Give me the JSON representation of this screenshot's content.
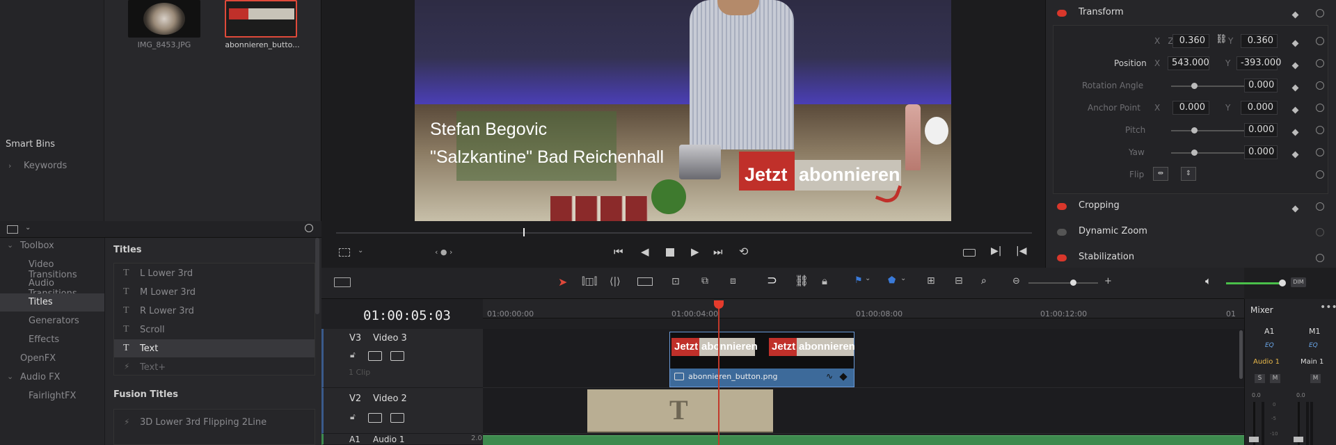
{
  "media_pool": {
    "clips": [
      {
        "label": "IMG_8453.JPG"
      },
      {
        "label": "abonnieren_butto..."
      }
    ],
    "smart_bins_label": "Smart Bins",
    "keywords_label": "Keywords"
  },
  "viewer": {
    "overlay_line1": "Stefan Begovic",
    "overlay_line2": "\"Salzkantine\" Bad Reichenhall",
    "button_text_1": "Jetzt",
    "button_text_2": "abonnieren"
  },
  "inspector": {
    "transform_label": "Transform",
    "zoom_label": "Zoom",
    "zoom_x": "0.360",
    "zoom_y": "0.360",
    "position_label": "Position",
    "position_x": "543.000",
    "position_y": "-393.000",
    "rotation_label": "Rotation Angle",
    "rotation_value": "0.000",
    "anchor_label": "Anchor Point",
    "anchor_x": "0.000",
    "anchor_y": "0.000",
    "pitch_label": "Pitch",
    "pitch_value": "0.000",
    "yaw_label": "Yaw",
    "yaw_value": "0.000",
    "flip_label": "Flip",
    "x_axis": "X",
    "y_axis": "Y",
    "cropping_label": "Cropping",
    "dynamic_zoom_label": "Dynamic Zoom",
    "stabilization_label": "Stabilization"
  },
  "effects": {
    "toolbox": [
      {
        "label": "Toolbox"
      },
      {
        "label": "Video Transitions"
      },
      {
        "label": "Audio Transitions"
      },
      {
        "label": "Titles"
      },
      {
        "label": "Generators"
      },
      {
        "label": "Effects"
      },
      {
        "label": "OpenFX"
      },
      {
        "label": "Audio FX"
      },
      {
        "label": "FairlightFX"
      }
    ],
    "titles_header": "Titles",
    "titles": [
      {
        "label": "L Lower 3rd"
      },
      {
        "label": "M Lower 3rd"
      },
      {
        "label": "R Lower 3rd"
      },
      {
        "label": "Scroll"
      },
      {
        "label": "Text"
      },
      {
        "label": "Text+"
      }
    ],
    "fusion_header": "Fusion Titles",
    "fusion_items": [
      {
        "label": "3D Lower 3rd Flipping 2Line"
      }
    ]
  },
  "timeline": {
    "timecode": "01:00:05:03",
    "ruler": [
      "01:00:00:00",
      "01:00:04:00",
      "01:00:08:00",
      "01:00:12:00",
      "01"
    ],
    "tracks": [
      {
        "id": "V3",
        "name": "Video 3",
        "clips": "1 Clip"
      },
      {
        "id": "V2",
        "name": "Video 2"
      },
      {
        "id": "A1",
        "name": "Audio 1",
        "level": "2.0"
      }
    ],
    "clip_name": "abonnieren_button.png",
    "text_clip_glyph": "T",
    "dim_label": "DIM"
  },
  "mixer": {
    "title": "Mixer",
    "channels": [
      "A1",
      "M1"
    ],
    "eq": "EQ",
    "audio1": "Audio 1",
    "main1": "Main 1",
    "s": "S",
    "m": "M",
    "level": "0.0",
    "scale": [
      "0",
      "-5",
      "-10"
    ]
  },
  "colors": {
    "accent_red": "#d9372b",
    "clip_blue": "#3d6a9a",
    "audio_green": "#3d8a4e",
    "playhead": "#e53b2c"
  }
}
